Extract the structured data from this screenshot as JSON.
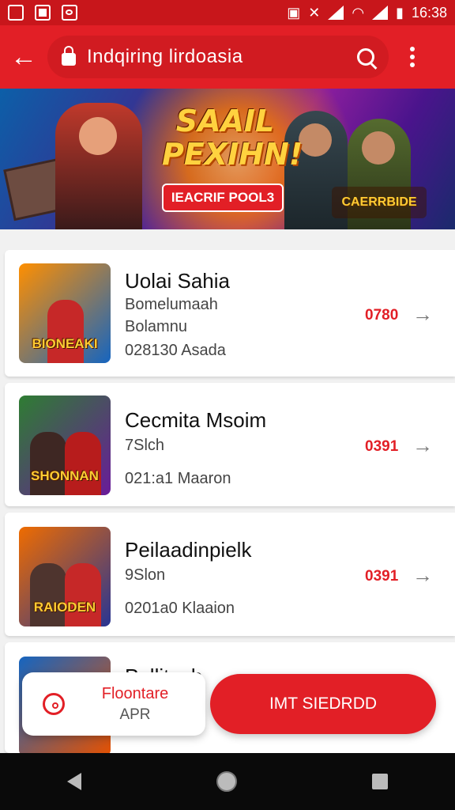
{
  "status_bar": {
    "time": "16:38"
  },
  "top_bar": {
    "search_text": "Indqiring lirdoasia"
  },
  "banner": {
    "title_line1": "SAAIL",
    "title_line2": "PEXIHN!",
    "pill_label": "IEACRIF POOL3",
    "logo_text": "CAERRBIDE"
  },
  "items": [
    {
      "title": "Uolai Sahia",
      "sub1": "Bomelumaah",
      "sub2": "Bolamnu",
      "sub3": "028130 Asada",
      "price": "0780",
      "thumb_caption": "BIONEAKI",
      "thumb_colors": [
        "#ff8f00",
        "#1565c0"
      ]
    },
    {
      "title": "Cecmita Msoim",
      "sub1": "7Slch",
      "sub2": "",
      "sub3": "021:a1 Maaron",
      "price": "0391",
      "thumb_caption": "SHONNAN",
      "thumb_colors": [
        "#2e7d32",
        "#6a1b9a"
      ]
    },
    {
      "title": "Peilaadinpielk",
      "sub1": "9Slon",
      "sub2": "",
      "sub3": "0201a0 Klaaion",
      "price": "0391",
      "thumb_caption": "RAIODEN",
      "thumb_colors": [
        "#ef6c00",
        "#283593"
      ]
    },
    {
      "title": "Pollitasb",
      "sub1": "",
      "sub2": "",
      "sub3": "",
      "price": "",
      "thumb_caption": "",
      "thumb_colors": [
        "#1565c0",
        "#e65100"
      ]
    }
  ],
  "float_left": {
    "title": "Floontare",
    "sub": "APR"
  },
  "float_right": {
    "label": "IMT SIEDRDD"
  },
  "colors": {
    "brand": "#e21f26",
    "status_bar": "#c8161b"
  }
}
